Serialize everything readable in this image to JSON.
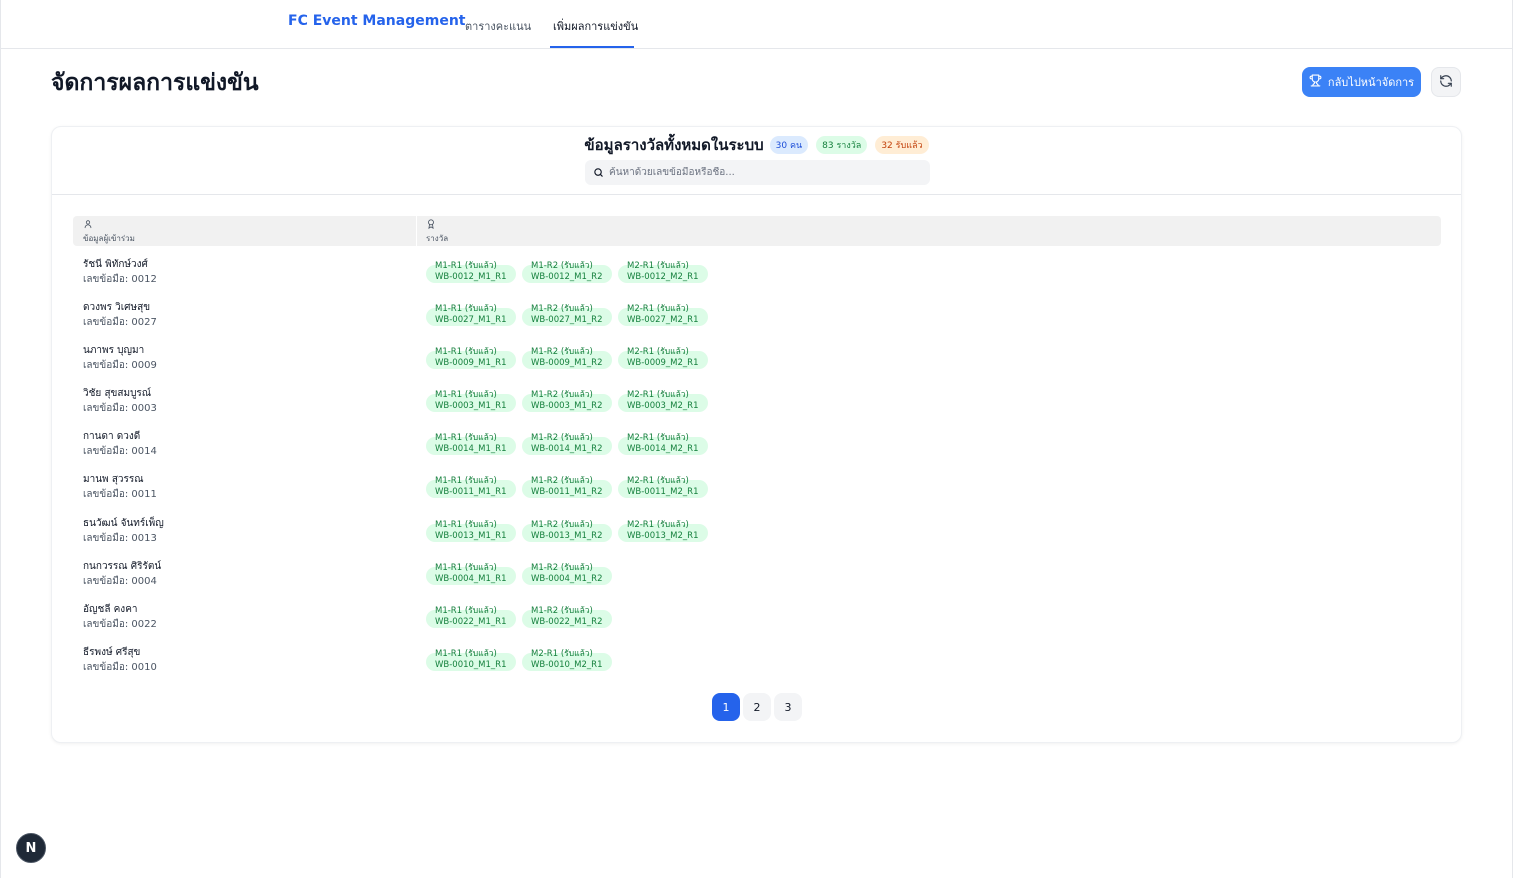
{
  "nav": {
    "brand": "FC Event Management",
    "tabs": [
      {
        "label": "ตารางคะแนน",
        "active": false
      },
      {
        "label": "เพิ่มผลการแข่งขัน",
        "active": true
      }
    ]
  },
  "header": {
    "title": "จัดการผลการแข่งขัน",
    "back_button_label": "กลับไปหน้าจัดการ"
  },
  "card": {
    "title": "ข้อมูลรางวัลทั้งหมดในระบบ",
    "badges": {
      "people": "30 คน",
      "awards": "83 รางวัล",
      "received": "32 รับแล้ว"
    },
    "search_placeholder": "ค้นหาด้วยเลขข้อมือหรือชื่อ..."
  },
  "table": {
    "columns": [
      "ข้อมูลผู้เข้าร่วม",
      "รางวัล"
    ],
    "rows": [
      {
        "name": "รัชนี พิทักษ์วงศ์",
        "id": "เลขข้อมือ: 0012",
        "awards": [
          {
            "l1": "M1-R1 (รับแล้ว)",
            "l2": "WB-0012_M1_R1"
          },
          {
            "l1": "M1-R2 (รับแล้ว)",
            "l2": "WB-0012_M1_R2"
          },
          {
            "l1": "M2-R1 (รับแล้ว)",
            "l2": "WB-0012_M2_R1"
          }
        ]
      },
      {
        "name": "ดวงพร วิเศษสุข",
        "id": "เลขข้อมือ: 0027",
        "awards": [
          {
            "l1": "M1-R1 (รับแล้ว)",
            "l2": "WB-0027_M1_R1"
          },
          {
            "l1": "M1-R2 (รับแล้ว)",
            "l2": "WB-0027_M1_R2"
          },
          {
            "l1": "M2-R1 (รับแล้ว)",
            "l2": "WB-0027_M2_R1"
          }
        ]
      },
      {
        "name": "นภาพร บุญมา",
        "id": "เลขข้อมือ: 0009",
        "awards": [
          {
            "l1": "M1-R1 (รับแล้ว)",
            "l2": "WB-0009_M1_R1"
          },
          {
            "l1": "M1-R2 (รับแล้ว)",
            "l2": "WB-0009_M1_R2"
          },
          {
            "l1": "M2-R1 (รับแล้ว)",
            "l2": "WB-0009_M2_R1"
          }
        ]
      },
      {
        "name": "วิชัย สุขสมบูรณ์",
        "id": "เลขข้อมือ: 0003",
        "awards": [
          {
            "l1": "M1-R1 (รับแล้ว)",
            "l2": "WB-0003_M1_R1"
          },
          {
            "l1": "M1-R2 (รับแล้ว)",
            "l2": "WB-0003_M1_R2"
          },
          {
            "l1": "M2-R1 (รับแล้ว)",
            "l2": "WB-0003_M2_R1"
          }
        ]
      },
      {
        "name": "กานดา ดวงดี",
        "id": "เลขข้อมือ: 0014",
        "awards": [
          {
            "l1": "M1-R1 (รับแล้ว)",
            "l2": "WB-0014_M1_R1"
          },
          {
            "l1": "M1-R2 (รับแล้ว)",
            "l2": "WB-0014_M1_R2"
          },
          {
            "l1": "M2-R1 (รับแล้ว)",
            "l2": "WB-0014_M2_R1"
          }
        ]
      },
      {
        "name": "มานพ สุวรรณ",
        "id": "เลขข้อมือ: 0011",
        "awards": [
          {
            "l1": "M1-R1 (รับแล้ว)",
            "l2": "WB-0011_M1_R1"
          },
          {
            "l1": "M1-R2 (รับแล้ว)",
            "l2": "WB-0011_M1_R2"
          },
          {
            "l1": "M2-R1 (รับแล้ว)",
            "l2": "WB-0011_M2_R1"
          }
        ]
      },
      {
        "name": "ธนวัฒน์ จันทร์เพ็ญ",
        "id": "เลขข้อมือ: 0013",
        "awards": [
          {
            "l1": "M1-R1 (รับแล้ว)",
            "l2": "WB-0013_M1_R1"
          },
          {
            "l1": "M1-R2 (รับแล้ว)",
            "l2": "WB-0013_M1_R2"
          },
          {
            "l1": "M2-R1 (รับแล้ว)",
            "l2": "WB-0013_M2_R1"
          }
        ]
      },
      {
        "name": "กนกวรรณ ศิริรัตน์",
        "id": "เลขข้อมือ: 0004",
        "awards": [
          {
            "l1": "M1-R1 (รับแล้ว)",
            "l2": "WB-0004_M1_R1"
          },
          {
            "l1": "M1-R2 (รับแล้ว)",
            "l2": "WB-0004_M1_R2"
          }
        ]
      },
      {
        "name": "อัญชลี คงคา",
        "id": "เลขข้อมือ: 0022",
        "awards": [
          {
            "l1": "M1-R1 (รับแล้ว)",
            "l2": "WB-0022_M1_R1"
          },
          {
            "l1": "M1-R2 (รับแล้ว)",
            "l2": "WB-0022_M1_R2"
          }
        ]
      },
      {
        "name": "ธีรพงษ์ ศรีสุข",
        "id": "เลขข้อมือ: 0010",
        "awards": [
          {
            "l1": "M1-R1 (รับแล้ว)",
            "l2": "WB-0010_M1_R1"
          },
          {
            "l1": "M2-R1 (รับแล้ว)",
            "l2": "WB-0010_M2_R1"
          }
        ]
      }
    ]
  },
  "pagination": {
    "pages": [
      "1",
      "2",
      "3"
    ],
    "current": "1"
  },
  "dev_badge": "N",
  "colors": {
    "accent": "#2563eb",
    "button": "#3b82f6",
    "award_pill": "#dcfce7",
    "award_text": "#15803d"
  }
}
